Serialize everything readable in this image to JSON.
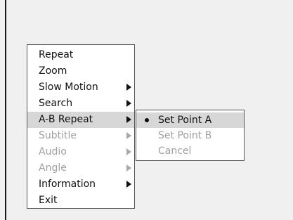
{
  "menu": {
    "items": [
      {
        "label": "Repeat",
        "has_submenu": false,
        "disabled": false,
        "selected": false
      },
      {
        "label": "Zoom",
        "has_submenu": false,
        "disabled": false,
        "selected": false
      },
      {
        "label": "Slow Motion",
        "has_submenu": true,
        "disabled": false,
        "selected": false
      },
      {
        "label": "Search",
        "has_submenu": true,
        "disabled": false,
        "selected": false
      },
      {
        "label": "A-B Repeat",
        "has_submenu": true,
        "disabled": false,
        "selected": true
      },
      {
        "label": "Subtitle",
        "has_submenu": true,
        "disabled": true,
        "selected": false
      },
      {
        "label": "Audio",
        "has_submenu": true,
        "disabled": true,
        "selected": false
      },
      {
        "label": "Angle",
        "has_submenu": true,
        "disabled": true,
        "selected": false
      },
      {
        "label": "Information",
        "has_submenu": true,
        "disabled": false,
        "selected": false
      },
      {
        "label": "Exit",
        "has_submenu": false,
        "disabled": false,
        "selected": false
      }
    ]
  },
  "submenu": {
    "items": [
      {
        "label": "Set Point A",
        "bullet": true,
        "disabled": false,
        "selected": true
      },
      {
        "label": "Set Point B",
        "bullet": false,
        "disabled": true,
        "selected": false
      },
      {
        "label": "Cancel",
        "bullet": false,
        "disabled": true,
        "selected": false
      }
    ]
  },
  "colors": {
    "background": "#f0f0f0",
    "highlight": "#d7d7d7",
    "text": "#111111",
    "disabled_text": "#a0a0a0"
  }
}
